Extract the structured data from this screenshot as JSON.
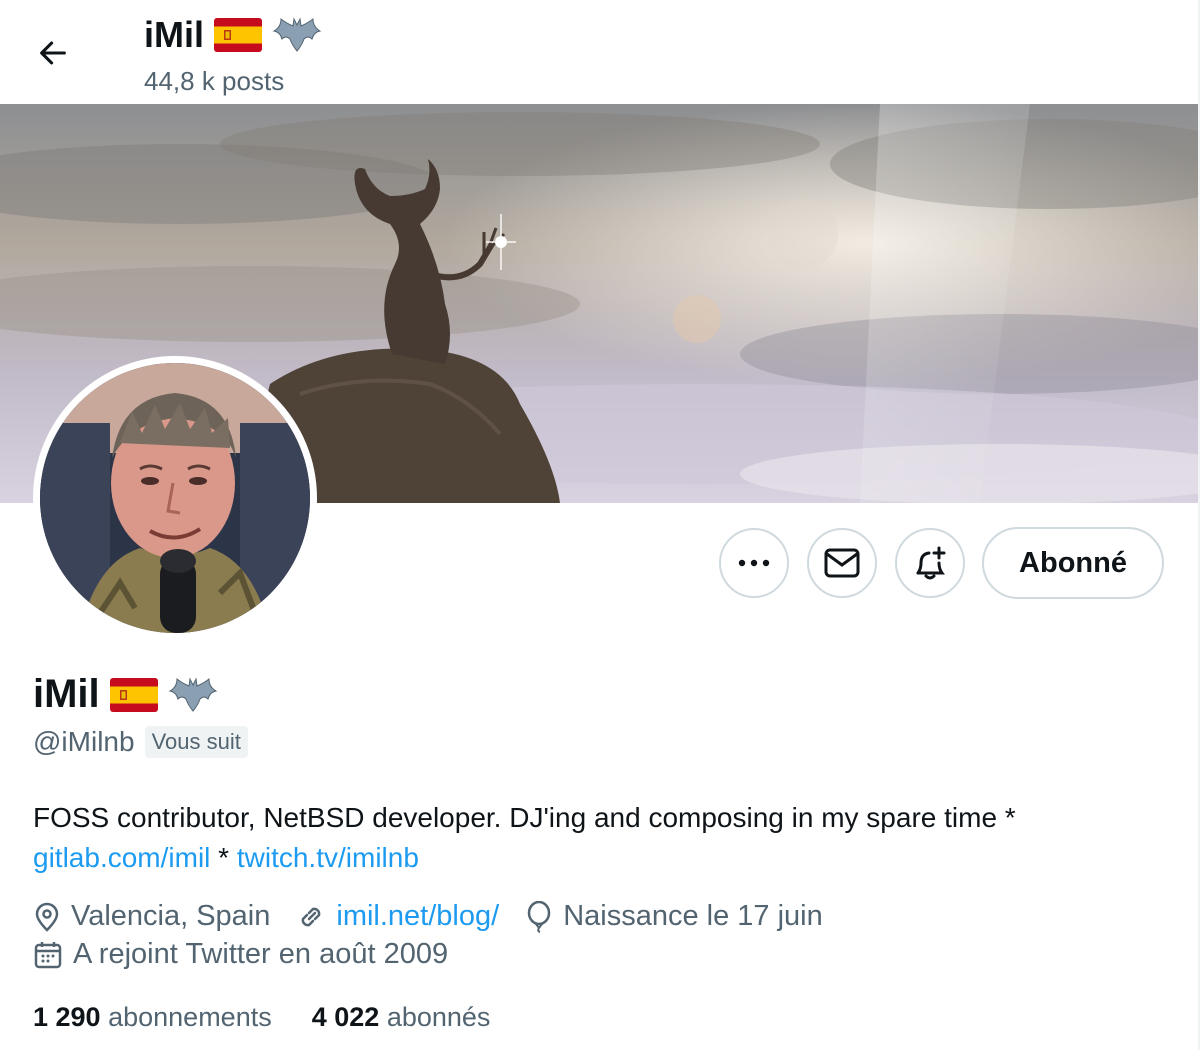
{
  "header": {
    "back_icon": "arrow-left-icon",
    "name": "iMil",
    "posts": "44,8 k posts"
  },
  "banner": {
    "alt": "Profile banner"
  },
  "actions": {
    "more_icon": "more-horizontal-icon",
    "message_icon": "envelope-icon",
    "notify_icon": "bell-plus-icon",
    "follow_label": "Abonné"
  },
  "profile": {
    "name": "iMil",
    "handle": "@iMilnb",
    "follows_you": "Vous suit",
    "flag_icon": "spain-flag-icon",
    "bat_icon": "bat-icon",
    "bio_text": "FOSS contributor, NetBSD developer. DJ'ing and composing in my spare time *",
    "bio_link1": "gitlab.com/imil",
    "bio_sep": " * ",
    "bio_link2": "twitch.tv/imilnb"
  },
  "meta": {
    "location": "Valencia, Spain",
    "website": "imil.net/blog/",
    "birthday": "Naissance le 17 juin",
    "joined": "A rejoint Twitter en août 2009"
  },
  "stats": {
    "following_count": "1 290",
    "following_label": "abonnements",
    "followers_count": "4 022",
    "followers_label": "abonnés"
  },
  "colors": {
    "link": "#1d9bf0",
    "muted": "#536471",
    "text": "#0f1419",
    "border": "#cfd9de"
  }
}
